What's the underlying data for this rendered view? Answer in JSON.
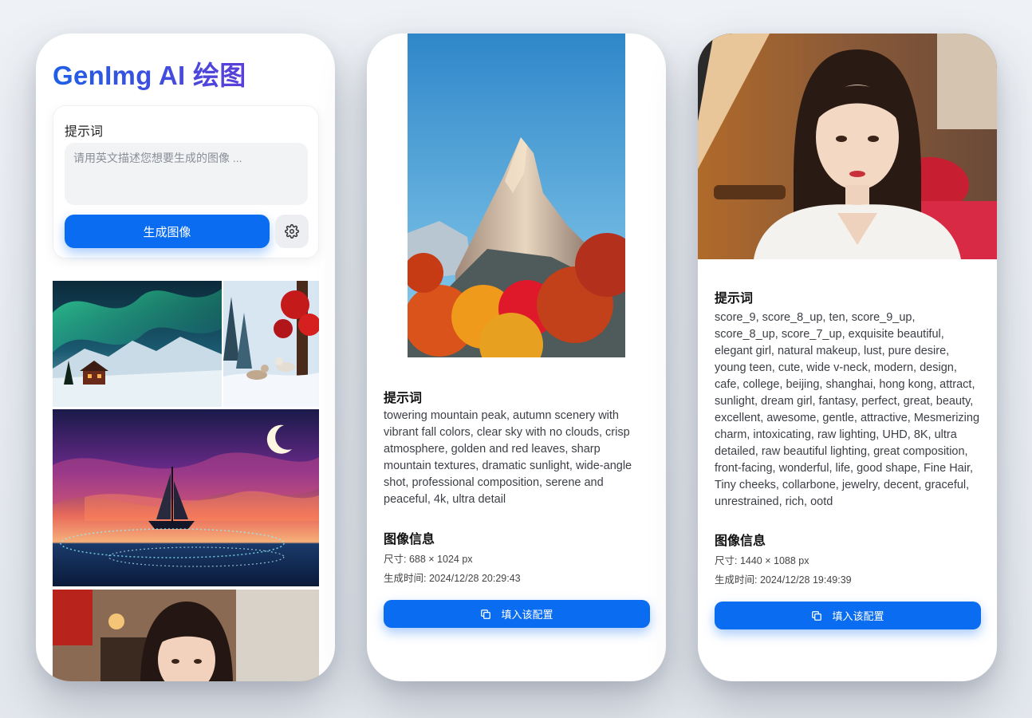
{
  "phone1": {
    "app_title": "GenImg AI 绘图",
    "prompt_label": "提示词",
    "prompt_placeholder": "请用英文描述您想要生成的图像 ...",
    "generate_button": "生成图像",
    "settings_icon": "gear-icon",
    "gallery_images": [
      "aurora-cabin-image",
      "arctic-foxes-image",
      "sailing-ship-sunset-image",
      "girl-portrait-image"
    ]
  },
  "phone2": {
    "hero_image": "autumn-mountain-image",
    "prompt_title": "提示词",
    "prompt_text": "towering mountain peak, autumn scenery with vibrant fall colors, clear sky with no clouds, crisp atmosphere, golden and red leaves, sharp mountain textures, dramatic sunlight, wide-angle shot, professional composition, serene and peaceful, 4k, ultra detail",
    "info_title": "图像信息",
    "size_line": "尺寸: 688 × 1024 px",
    "time_line": "生成时间: 2024/12/28 20:29:43",
    "fill_button": "填入该配置",
    "copy_icon": "copy-icon"
  },
  "phone3": {
    "hero_image": "woman-cafe-portrait-image",
    "prompt_title": "提示词",
    "prompt_text": "score_9, score_8_up, ten, score_9_up, score_8_up, score_7_up, exquisite beautiful, elegant girl, natural makeup, lust, pure desire, young teen, cute, wide v-neck, modern, design, cafe, college, beijing, shanghai, hong kong, attract, sunlight, dream girl, fantasy, perfect, great, beauty, excellent, awesome, gentle, attractive, Mesmerizing charm, intoxicating, raw lighting, UHD, 8K, ultra detailed, raw beautiful lighting, great composition, front-facing, wonderful, life, good shape, Fine Hair, Tiny cheeks, collarbone, jewelry, decent, graceful, unrestrained, rich, ootd",
    "info_title": "图像信息",
    "size_line": "尺寸: 1440 × 1088 px",
    "time_line": "生成时间: 2024/12/28 19:49:39",
    "fill_button": "填入该配置",
    "copy_icon": "copy-icon"
  },
  "colors": {
    "accent": "#0a6cf0",
    "title_gradient_start": "#1f5fe6",
    "title_gradient_end": "#5b3fd8"
  }
}
